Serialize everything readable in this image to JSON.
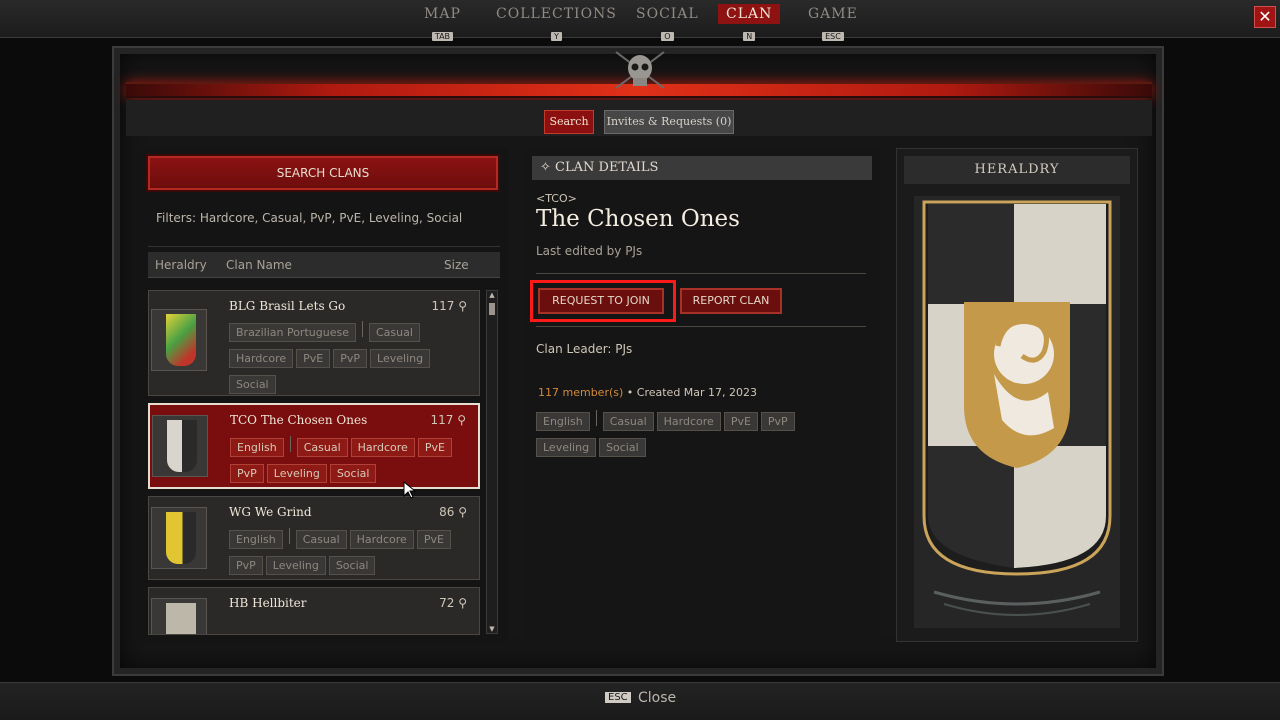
{
  "nav": {
    "items": [
      {
        "label": "MAP",
        "key": "TAB"
      },
      {
        "label": "COLLECTIONS",
        "key": "Y"
      },
      {
        "label": "SOCIAL",
        "key": "O"
      },
      {
        "label": "CLAN",
        "key": "N",
        "active": true
      },
      {
        "label": "GAME",
        "key": "ESC"
      }
    ]
  },
  "tabs": {
    "search": "Search",
    "invites": "Invites & Requests (0)"
  },
  "left": {
    "search_button": "SEARCH CLANS",
    "filters": "Filters: Hardcore, Casual, PvP, PvE, Leveling, Social",
    "headers": {
      "heraldry": "Heraldry",
      "clan_name": "Clan Name",
      "size": "Size"
    },
    "clans": [
      {
        "title": "BLG  Brasil Lets Go",
        "size": "117",
        "tags": [
          "Brazilian Portuguese",
          "|",
          "Casual",
          "Hardcore",
          "PvE",
          "PvP",
          "Leveling",
          "Social"
        ]
      },
      {
        "title": "TCO  The Chosen Ones",
        "size": "117",
        "tags": [
          "English",
          "|",
          "Casual",
          "Hardcore",
          "PvE",
          "PvP",
          "Leveling",
          "Social"
        ],
        "selected": true
      },
      {
        "title": "WG  We Grind",
        "size": "86",
        "tags": [
          "English",
          "|",
          "Casual",
          "Hardcore",
          "PvE",
          "PvP",
          "Leveling",
          "Social"
        ]
      },
      {
        "title": "HB  Hellbiter",
        "size": "72",
        "tags": []
      }
    ]
  },
  "details": {
    "header": "CLAN DETAILS",
    "tag": "<TCO>",
    "name": "The Chosen Ones",
    "last_edited": "Last edited by PJs",
    "request_button": "REQUEST TO JOIN",
    "report_button": "REPORT CLAN",
    "leader": "Clan Leader: PJs",
    "members_count": "117 member(s)",
    "created": " • Created Mar 17, 2023",
    "tags": [
      "English",
      "|",
      "Casual",
      "Hardcore",
      "PvE",
      "PvP",
      "Leveling",
      "Social"
    ]
  },
  "heraldry": {
    "header": "HERALDRY"
  },
  "footer": {
    "key": "ESC",
    "label": "Close"
  },
  "colors": {
    "accent_red": "#8c1010",
    "highlight": "#ff1a1a",
    "member_count": "#d18a3a"
  }
}
